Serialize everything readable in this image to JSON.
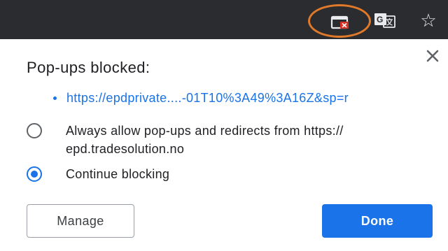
{
  "toolbar": {
    "popup_blocked_icon": "popup-blocked-icon",
    "translate_icon": "translate-icon",
    "bookmark_icon": "star-icon",
    "star_glyph": "☆"
  },
  "dialog": {
    "close_glyph": "✕",
    "title": "Pop-ups blocked:",
    "blocked_url": "https://epdprivate....-01T10%3A49%3A16Z&sp=r",
    "options": {
      "allow_label": "Always allow pop-ups and redirects from https:// epd.tradesolution.no",
      "allow_selected": false,
      "block_label": "Continue blocking",
      "block_selected": true
    },
    "manage_label": "Manage",
    "done_label": "Done"
  },
  "colors": {
    "toolbar_bg": "#2b2c2f",
    "accent": "#1a73e8",
    "highlight_ring": "#e07a2a"
  }
}
